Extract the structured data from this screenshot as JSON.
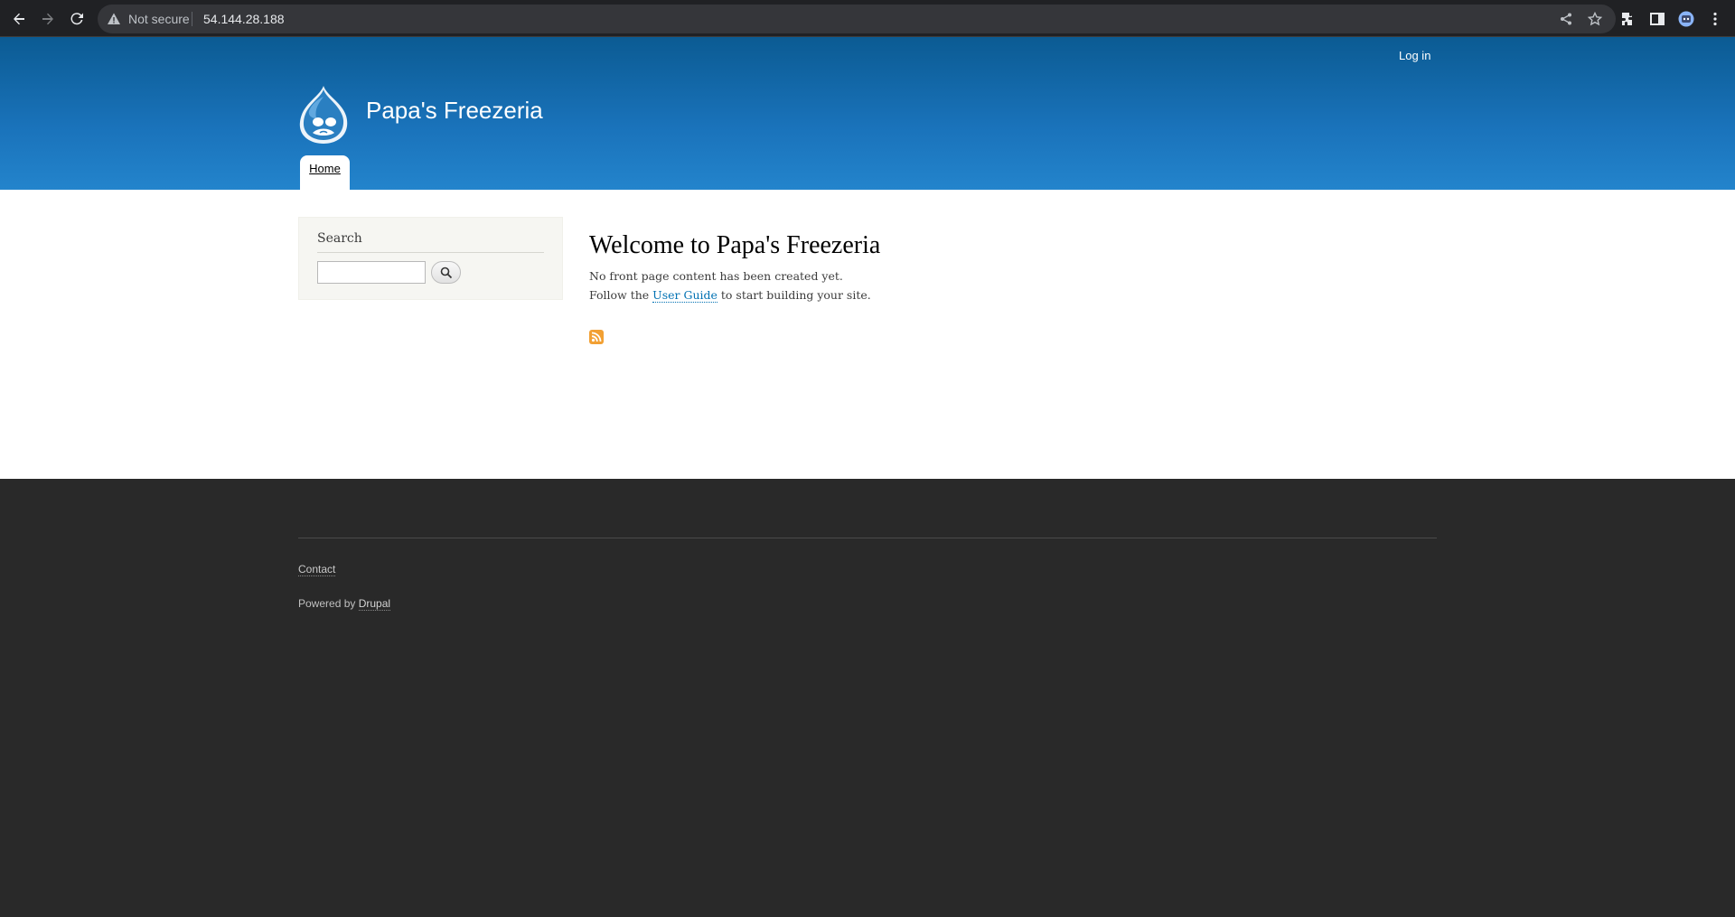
{
  "browser": {
    "security_label": "Not secure",
    "url": "54.144.28.188"
  },
  "header": {
    "site_name": "Papa's Freezeria",
    "login_link": "Log in",
    "nav": [
      {
        "label": "Home"
      }
    ]
  },
  "sidebar": {
    "search_block_title": "Search",
    "search_value": ""
  },
  "content": {
    "title": "Welcome to Papa's Freezeria",
    "line1": "No front page content has been created yet.",
    "line2_prefix": "Follow the",
    "line2_link": "User Guide",
    "line2_suffix": "to start building your site."
  },
  "footer": {
    "contact_link": "Contact",
    "powered_prefix": "Powered by",
    "powered_link": "Drupal"
  },
  "colors": {
    "header_top": "#0b5b93",
    "header_bottom": "#2384cc",
    "link": "#0071b3",
    "footer_bg": "#292929"
  }
}
